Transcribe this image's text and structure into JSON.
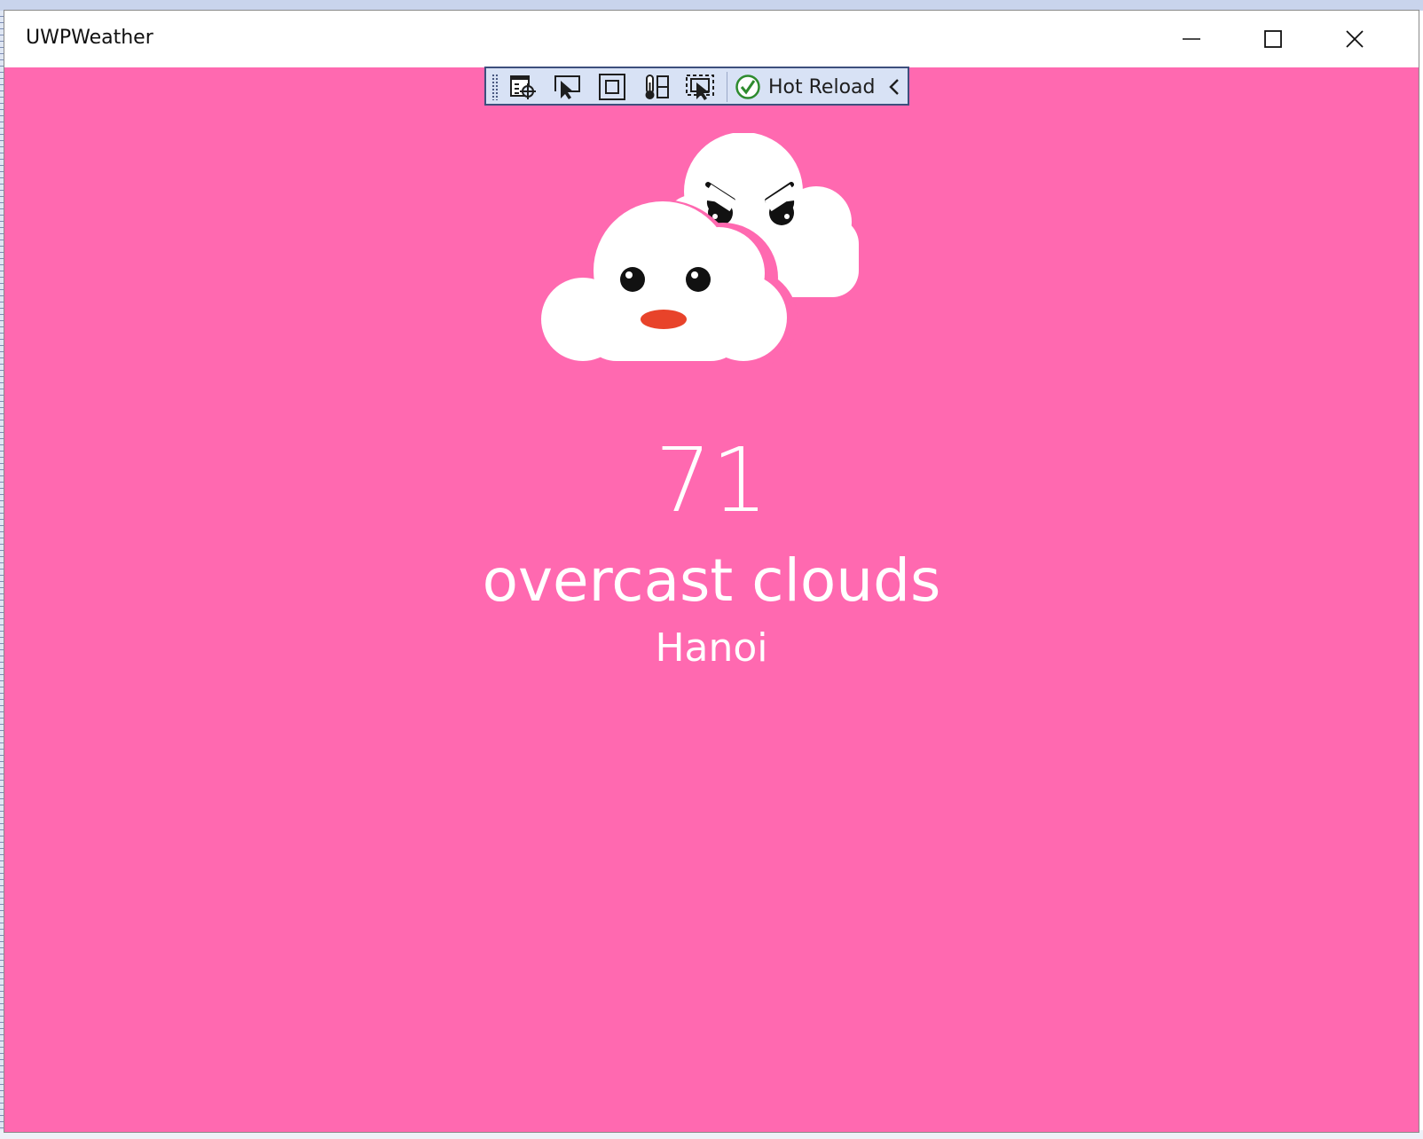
{
  "window": {
    "title": "UWPWeather",
    "background_color": "#ff69b0"
  },
  "caption_buttons": {
    "minimize_icon": "minimize-icon",
    "maximize_icon": "maximize-icon",
    "close_icon": "close-icon"
  },
  "dev_toolbar": {
    "tools": [
      {
        "name": "go-to-live-visual-tree",
        "icon": "live-visual-tree-icon"
      },
      {
        "name": "select-element",
        "icon": "select-element-icon"
      },
      {
        "name": "display-layout-adorners",
        "icon": "layout-adorner-icon"
      },
      {
        "name": "track-focus",
        "icon": "track-focus-icon"
      },
      {
        "name": "binding-failures",
        "icon": "select-preview-icon"
      }
    ],
    "hot_reload_label": "Hot Reload",
    "hot_reload_status_color": "#2e8b2e"
  },
  "weather": {
    "temperature": "71",
    "description": "overcast clouds",
    "city": "Hanoi",
    "icon": "angry-clouds-icon"
  }
}
